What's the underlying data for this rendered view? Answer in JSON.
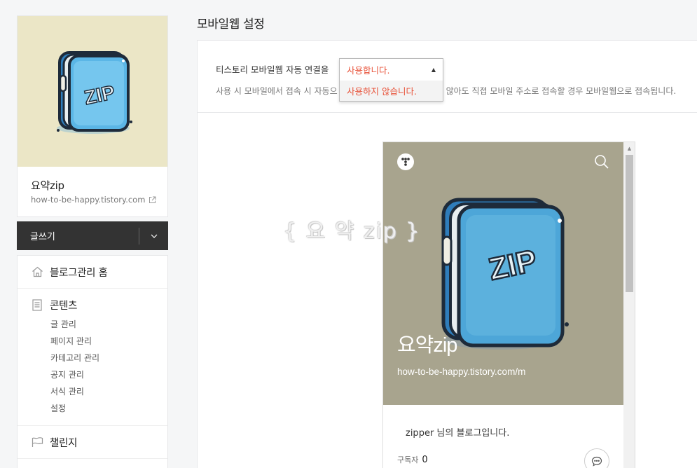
{
  "sidebar": {
    "profile": {
      "name": "요약zip",
      "url": "how-to-be-happy.tistory.com"
    },
    "write_label": "글쓰기",
    "menu": {
      "home": "블로그관리 홈",
      "content": {
        "label": "콘텐츠",
        "items": [
          "글 관리",
          "페이지 관리",
          "카테고리 관리",
          "공지 관리",
          "서식 관리",
          "설정"
        ]
      },
      "challenge": "챌린지"
    }
  },
  "main": {
    "title": "모바일웹 설정",
    "setting": {
      "label": "티스토리 모바일웹 자동 연결을",
      "selected": "사용합니다.",
      "options": [
        "사용하지 않습니다."
      ],
      "desc_left": "사용 시 모바일에서 접속 시 자동으",
      "desc_right": "용하지 않아도 직접 모바일 주소로 접속할 경우 모바일웹으로 접속됩니다."
    }
  },
  "preview": {
    "blog_title": "요약zip",
    "blog_url": "how-to-be-happy.tistory.com/m",
    "description": "zipper 님의 블로그입니다.",
    "subscribers_label": "구독자",
    "subscribers_count": "0"
  },
  "watermark": "{ 요 약 zip }",
  "colors": {
    "accent": "#e8533a",
    "write_bar": "#333333",
    "hero_bg": "#a8a48e",
    "profile_bg": "#ebe6c6"
  }
}
